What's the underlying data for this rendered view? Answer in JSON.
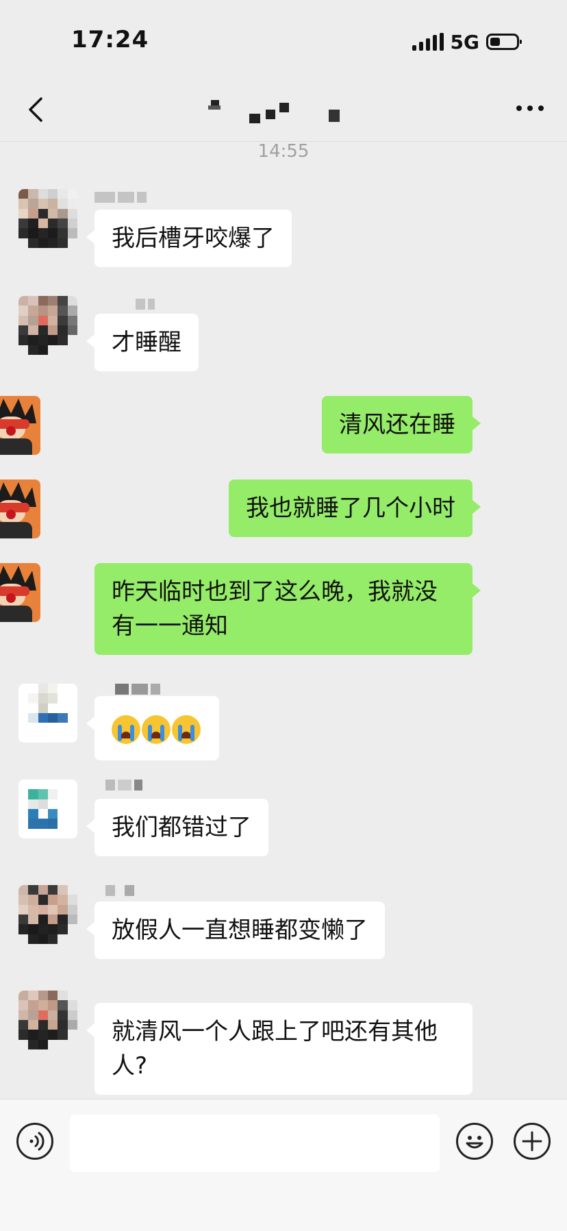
{
  "status_bar": {
    "time": "17:24",
    "network": "5G"
  },
  "chat": {
    "timestamp": "14:55"
  },
  "messages": [
    {
      "side": "left",
      "text": "我后槽牙咬爆了"
    },
    {
      "side": "left",
      "text": "才睡醒"
    },
    {
      "side": "right",
      "text": "清风还在睡"
    },
    {
      "side": "right",
      "text": "我也就睡了几个小时"
    },
    {
      "side": "right",
      "text": "昨天临时也到了这么晚，我就没有一一通知"
    },
    {
      "side": "left",
      "emoji": "loudly-crying-face",
      "count": 3
    },
    {
      "side": "left",
      "text": "我们都错过了"
    },
    {
      "side": "left",
      "text": "放假人一直想睡都变懒了"
    },
    {
      "side": "left",
      "text": "就清风一个人跟上了吧还有其他人?"
    }
  ],
  "input": {
    "value": ""
  },
  "colors": {
    "background": "#ededed",
    "sent_bubble": "#95ec69",
    "received_bubble": "#ffffff"
  },
  "icons": [
    "back-arrow-icon",
    "more-dots-icon",
    "voice-icon",
    "emoji-icon",
    "plus-icon"
  ]
}
